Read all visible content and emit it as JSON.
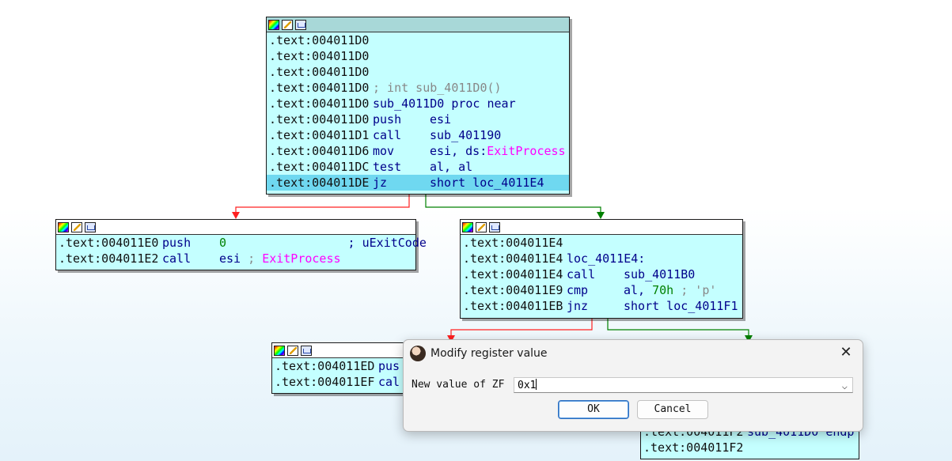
{
  "graph": {
    "node_top": {
      "lines": [
        {
          "addr": ".text:004011D0",
          "parts": []
        },
        {
          "addr": ".text:004011D0",
          "parts": []
        },
        {
          "addr": ".text:004011D0",
          "parts": []
        },
        {
          "addr": ".text:004011D0",
          "parts": [
            {
              "t": "; int sub_4011D0()",
              "c": "gray"
            }
          ]
        },
        {
          "addr": ".text:004011D0",
          "parts": [
            {
              "t": "sub_4011D0 proc near",
              "c": "blue"
            }
          ]
        },
        {
          "addr": ".text:004011D0",
          "mnem": "push",
          "parts": [
            {
              "t": "esi",
              "c": "blue"
            }
          ]
        },
        {
          "addr": ".text:004011D1",
          "mnem": "call",
          "parts": [
            {
              "t": "sub_401190",
              "c": "blue"
            }
          ]
        },
        {
          "addr": ".text:004011D6",
          "mnem": "mov",
          "parts": [
            {
              "t": "esi, ds:",
              "c": "blue"
            },
            {
              "t": "ExitProcess",
              "c": "pink"
            }
          ]
        },
        {
          "addr": ".text:004011DC",
          "mnem": "test",
          "parts": [
            {
              "t": "al, al",
              "c": "blue"
            }
          ]
        },
        {
          "addr": ".text:004011DE",
          "mnem": "jz",
          "parts": [
            {
              "t": "short loc_4011E4",
              "c": "blue"
            }
          ],
          "highlight": true
        }
      ]
    },
    "node_left": {
      "lines": [
        {
          "addr": ".text:004011E0",
          "mnem": "push",
          "parts": [
            {
              "t": "0",
              "c": "green"
            },
            {
              "t": "                 ; uExitCode",
              "c": "blue"
            }
          ]
        },
        {
          "addr": ".text:004011E2",
          "mnem": "call",
          "parts": [
            {
              "t": "esi",
              "c": "blue"
            },
            {
              "t": " ; ",
              "c": "gray"
            },
            {
              "t": "ExitProcess",
              "c": "pink"
            }
          ]
        }
      ]
    },
    "node_right": {
      "lines": [
        {
          "addr": ".text:004011E4",
          "parts": []
        },
        {
          "addr": ".text:004011E4",
          "parts": [
            {
              "t": "loc_4011E4:",
              "c": "blue"
            }
          ]
        },
        {
          "addr": ".text:004011E4",
          "mnem": "call",
          "parts": [
            {
              "t": "sub_4011B0",
              "c": "blue"
            }
          ]
        },
        {
          "addr": ".text:004011E9",
          "mnem": "cmp",
          "parts": [
            {
              "t": "al, ",
              "c": "blue"
            },
            {
              "t": "70h",
              "c": "green"
            },
            {
              "t": " ; 'p'",
              "c": "gray"
            }
          ]
        },
        {
          "addr": ".text:004011EB",
          "mnem": "jnz",
          "parts": [
            {
              "t": "short loc_4011F1",
              "c": "blue"
            }
          ]
        }
      ]
    },
    "node_bottom_left": {
      "lines": [
        {
          "addr": ".text:004011ED",
          "mnem": "pus",
          "parts": []
        },
        {
          "addr": ".text:004011EF",
          "mnem": "cal",
          "parts": []
        }
      ]
    },
    "node_bottom_right": {
      "lines": [
        {
          "addr": ".text:004011F2",
          "parts": [
            {
              "t": "sub_4011D0 endp",
              "c": "blue"
            }
          ]
        },
        {
          "addr": ".text:004011F2",
          "parts": []
        }
      ]
    },
    "colors": {
      "false_edge": "#ff2020",
      "true_edge": "#008000",
      "node_bg": "#c4ffff",
      "highlight": "#6fd8f0"
    }
  },
  "dialog": {
    "title": "Modify register value",
    "label": "New value of ZF",
    "input_value": "0x1",
    "ok_label": "OK",
    "cancel_label": "Cancel",
    "close_glyph": "✕",
    "dropdown_glyph": "⌵"
  }
}
